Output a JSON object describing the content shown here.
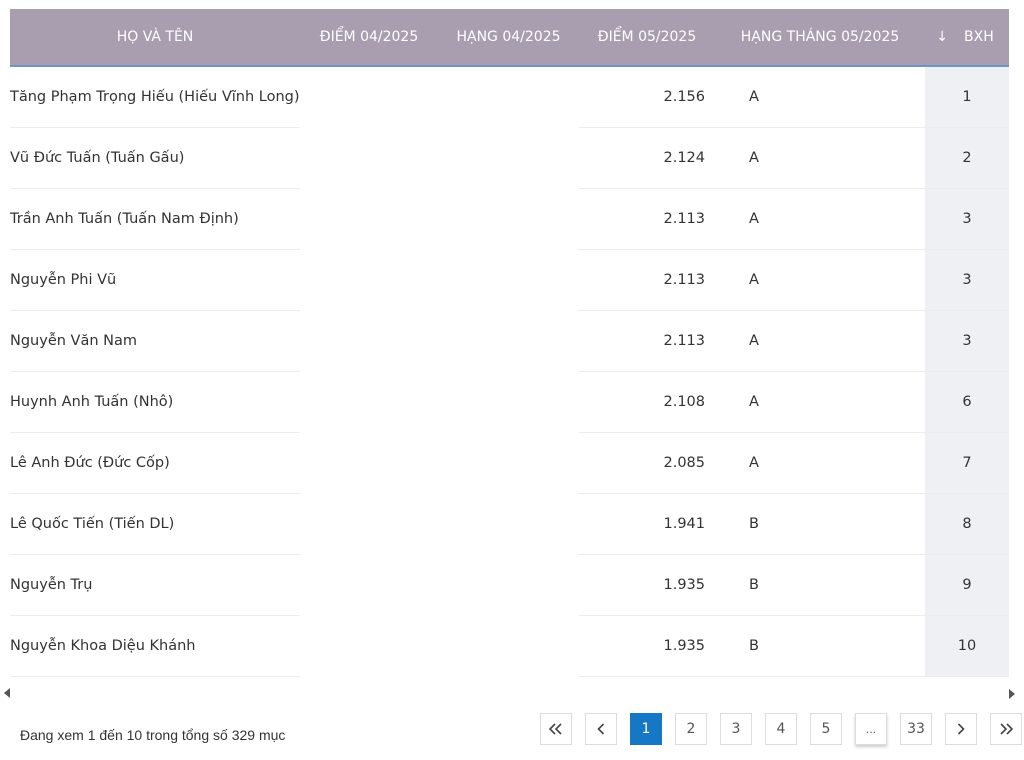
{
  "table": {
    "headers": {
      "name": "HỌ VÀ TÊN",
      "diem_04": "ĐIỂM 04/2025",
      "hang_04": "HẠNG 04/2025",
      "diem_05": "ĐIỂM 05/2025",
      "hang_05": "HẠNG THÁNG 05/2025",
      "bxh": "BXH"
    },
    "sort_icon": "arrow-down-icon",
    "rows": [
      {
        "name": "Tăng Phạm Trọng Hiếu (Hiếu Vĩnh Long)",
        "diem_04": "",
        "hang_04": "",
        "diem_05": "2.156",
        "hang_05": "A",
        "bxh": "1"
      },
      {
        "name": "Vũ Đức Tuấn (Tuấn Gấu)",
        "diem_04": "",
        "hang_04": "",
        "diem_05": "2.124",
        "hang_05": "A",
        "bxh": "2"
      },
      {
        "name": "Trần Anh Tuấn (Tuấn Nam Định)",
        "diem_04": "",
        "hang_04": "",
        "diem_05": "2.113",
        "hang_05": "A",
        "bxh": "3"
      },
      {
        "name": "Nguyễn Phi Vũ",
        "diem_04": "",
        "hang_04": "",
        "diem_05": "2.113",
        "hang_05": "A",
        "bxh": "3"
      },
      {
        "name": "Nguyễn Văn Nam",
        "diem_04": "",
        "hang_04": "",
        "diem_05": "2.113",
        "hang_05": "A",
        "bxh": "3"
      },
      {
        "name": "Huynh Anh Tuấn (Nhô)",
        "diem_04": "",
        "hang_04": "",
        "diem_05": "2.108",
        "hang_05": "A",
        "bxh": "6"
      },
      {
        "name": "Lê Anh Đức (Đức Cốp)",
        "diem_04": "",
        "hang_04": "",
        "diem_05": "2.085",
        "hang_05": "A",
        "bxh": "7"
      },
      {
        "name": "Lê Quốc Tiến (Tiến DL)",
        "diem_04": "",
        "hang_04": "",
        "diem_05": "1.941",
        "hang_05": "B",
        "bxh": "8"
      },
      {
        "name": "Nguyễn Trụ",
        "diem_04": "",
        "hang_04": "",
        "diem_05": "1.935",
        "hang_05": "B",
        "bxh": "9"
      },
      {
        "name": "Nguyễn Khoa Diệu Khánh",
        "diem_04": "",
        "hang_04": "",
        "diem_05": "1.935",
        "hang_05": "B",
        "bxh": "10"
      }
    ]
  },
  "info_text": "Đang xem 1 đến 10 trong tổng số 329 mục",
  "pagination": {
    "first_icon": "double-chevron-left-icon",
    "prev_icon": "chevron-left-icon",
    "pages": [
      "1",
      "2",
      "3",
      "4",
      "5"
    ],
    "ellipsis": "...",
    "last_page": "33",
    "current": "1",
    "next_icon": "chevron-right-icon",
    "last_icon": "double-chevron-right-icon"
  },
  "colors": {
    "header_bg": "#a99eaf",
    "header_border": "#6b96c6",
    "active_page": "#1677c7",
    "bxh_column_bg": "#eef0f4"
  }
}
